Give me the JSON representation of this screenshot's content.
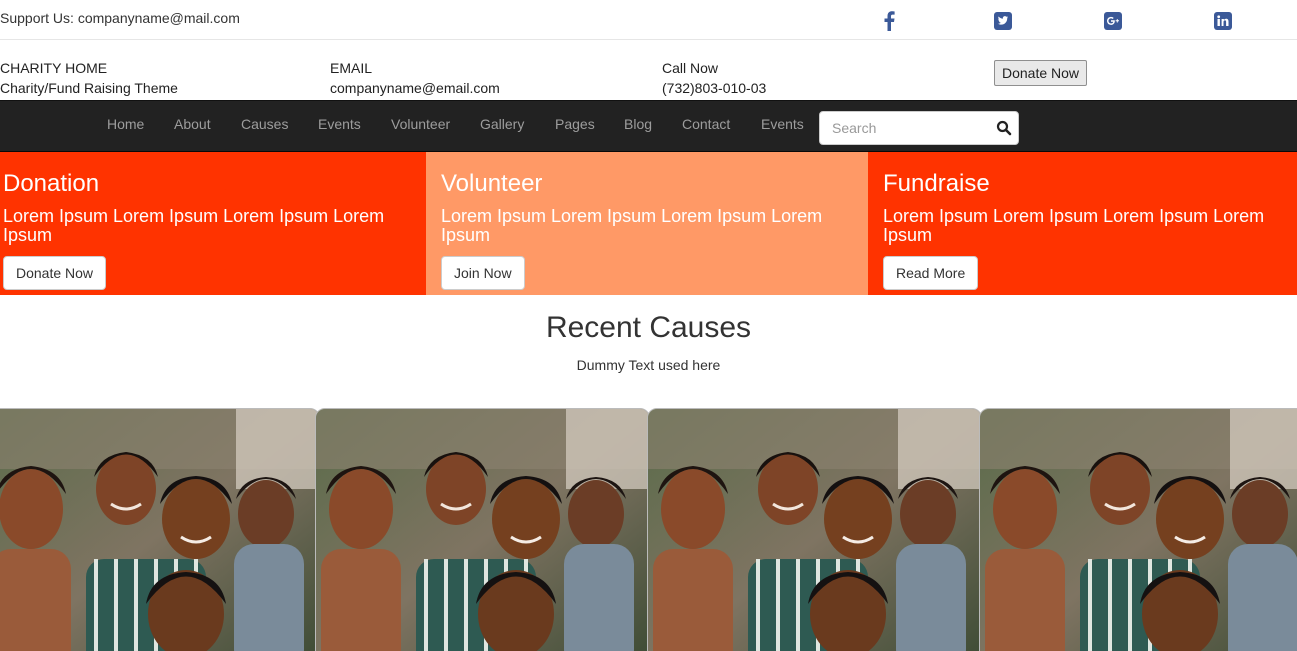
{
  "topbar": {
    "support_text": "Support Us: companyname@mail.com",
    "social_icons": [
      "facebook-icon",
      "twitter-icon",
      "google-plus-icon",
      "linkedin-icon"
    ]
  },
  "info": {
    "brand_title": "CHARITY HOME",
    "brand_subtitle": "Charity/Fund Raising Theme",
    "email_label": "EMAIL",
    "email_value": "companyname@email.com",
    "call_label": "Call Now",
    "call_value": "(732)803-010-03",
    "donate_button": "Donate Now"
  },
  "nav": {
    "items": [
      "Home",
      "About",
      "Causes",
      "Events",
      "Volunteer",
      "Gallery",
      "Pages",
      "Blog",
      "Contact",
      "Events"
    ],
    "search_placeholder": "Search"
  },
  "panels": [
    {
      "title": "Donation",
      "text": "Lorem Ipsum Lorem Ipsum Lorem Ipsum Lorem Ipsum",
      "button": "Donate Now",
      "color": "#ff3300"
    },
    {
      "title": "Volunteer",
      "text": "Lorem Ipsum Lorem Ipsum Lorem Ipsum Lorem Ipsum",
      "button": "Join Now",
      "color": "#ff9966"
    },
    {
      "title": "Fundraise",
      "text": "Lorem Ipsum Lorem Ipsum Lorem Ipsum Lorem Ipsum",
      "button": "Read More",
      "color": "#ff3300"
    }
  ],
  "recent_causes": {
    "title": "Recent Causes",
    "subtitle": "Dummy Text used here"
  },
  "colors": {
    "navbar": "#222222",
    "nav_text": "#9d9d9d",
    "social": "#3b5998"
  }
}
